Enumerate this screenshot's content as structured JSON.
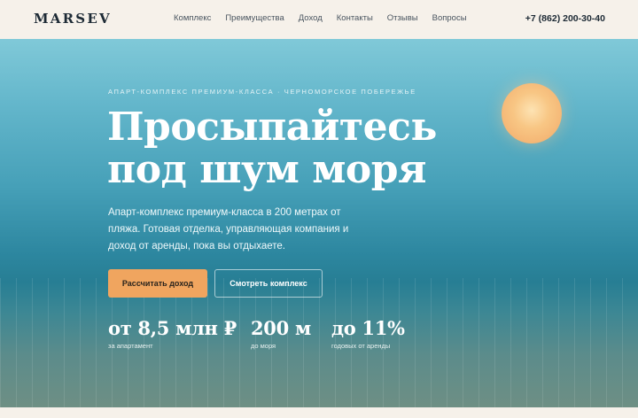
{
  "header": {
    "logo": "MARSEV",
    "nav": [
      "Комплекс",
      "Преимущества",
      "Доход",
      "Контакты",
      "Отзывы",
      "Вопросы"
    ],
    "phone": "+7 (862) 200-30-40"
  },
  "hero": {
    "eyebrow": "АПАРТ-КОМПЛЕКС ПРЕМИУМ-КЛАССА · ЧЕРНОМОРСКОЕ ПОБЕРЕЖЬЕ",
    "title_line1": "Просыпайтесь",
    "title_line2": "под шум моря",
    "lead": "Апарт-комплекс премиум-класса в 200 метрах от пляжа. Готовая отделка, управляющая компания и доход от аренды, пока вы отдыхаете.",
    "primary_button": "Рассчитать доход",
    "secondary_button": "Смотреть комплекс",
    "stats": [
      {
        "value": "от 8,5 млн ₽",
        "caption": "за апартамент"
      },
      {
        "value": "200 м",
        "caption": "до моря"
      },
      {
        "value": "до 11%",
        "caption": "годовых от аренды"
      }
    ]
  },
  "colors": {
    "header_bg": "#f6f1ea",
    "accent": "#f0a55f",
    "sea_top": "#80c9d8",
    "sea_deep": "#277e94"
  }
}
